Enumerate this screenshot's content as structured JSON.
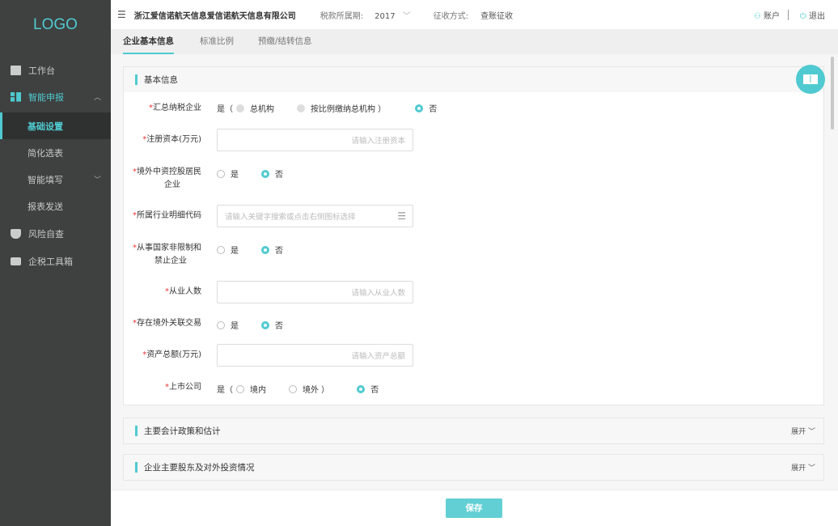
{
  "sidebar": {
    "logo": "LOGO",
    "items": [
      {
        "label": "工作台",
        "icon": "book-icon"
      },
      {
        "label": "智能申报",
        "icon": "grid-icon"
      },
      {
        "label": "基础设置"
      },
      {
        "label": "简化选表"
      },
      {
        "label": "智能填写"
      },
      {
        "label": "报表发送"
      },
      {
        "label": "风险自查",
        "icon": "shield-icon"
      },
      {
        "label": "企税工具箱",
        "icon": "toolbox-icon"
      }
    ]
  },
  "header": {
    "company": "浙江爱信诺航天信息爱信诺航天信息有限公司",
    "period_label": "税款所属期:",
    "period_value": "2017",
    "method_label": "征收方式:",
    "method_value": "查账征收",
    "account": "账户",
    "logout": "退出"
  },
  "tabs": [
    "企业基本信息",
    "标准比例",
    "预缴/结转信息"
  ],
  "basic": {
    "title": "基本信息",
    "f1": {
      "label": "汇总纳税企业",
      "prefix": "是（",
      "o1": "总机构",
      "o2": "按比例缴纳总机构 ）",
      "o3": "否"
    },
    "f2": {
      "label": "注册资本(万元)",
      "placeholder": "请输入注册资本"
    },
    "f3": {
      "label1": "境外中资控股居民",
      "label2": "企业",
      "yes": "是",
      "no": "否"
    },
    "f4": {
      "label": "所属行业明细代码",
      "placeholder": "请输入关键字搜索或点击右侧图标选择"
    },
    "f5": {
      "label1": "从事国家非限制和",
      "label2": "禁止企业",
      "yes": "是",
      "no": "否"
    },
    "f6": {
      "label": "从业人数",
      "placeholder": "请输入从业人数"
    },
    "f7": {
      "label": "存在境外关联交易",
      "yes": "是",
      "no": "否"
    },
    "f8": {
      "label": "资产总额(万元)",
      "placeholder": "请输入资产总额"
    },
    "f9": {
      "label": "上市公司",
      "prefix": "是（",
      "o1": "境内",
      "o2": "境外 ）",
      "o3": "否"
    }
  },
  "sections": [
    {
      "title": "主要会计政策和估计",
      "toggle": "展开"
    },
    {
      "title": "企业主要股东及对外投资情况",
      "toggle": "展开"
    }
  ],
  "footer": {
    "save": "保存"
  },
  "colors": {
    "accent": "#4fcad0",
    "sidebar": "#3f4141"
  }
}
